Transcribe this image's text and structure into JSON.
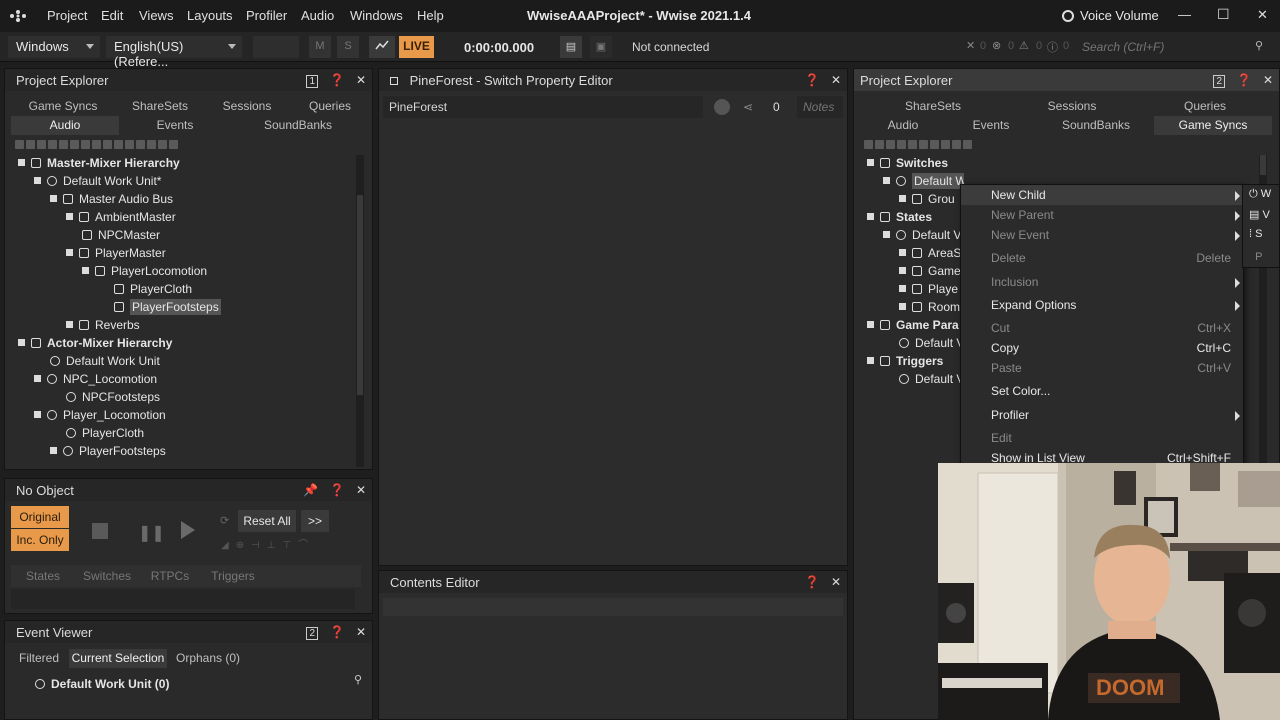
{
  "window": {
    "title": "WwiseAAAProject* - Wwise 2021.1.4",
    "voice_label": "Voice Volume",
    "minimize": "—",
    "maximize": "☐",
    "close": "✕"
  },
  "menu": [
    "Project",
    "Edit",
    "Views",
    "Layouts",
    "Profiler",
    "Audio",
    "Windows",
    "Help"
  ],
  "toolbar": {
    "layout_select": "Windows",
    "language_select": "English(US) (Refere...",
    "m_label": "M",
    "s_label": "S",
    "live_label": "LIVE",
    "time": "0:00:00.000",
    "connection_status": "Not connected",
    "error_count": "0",
    "warning_count": "0",
    "info_count": "0",
    "message_count": "0",
    "search_placeholder": "Search (Ctrl+F)",
    "colors": {
      "live_bg": "#e89a4a",
      "accent": "#e89a4a"
    }
  },
  "left_explorer": {
    "title": "Project Explorer",
    "badge": "1",
    "tabs_row1": [
      "Game Syncs",
      "ShareSets",
      "Sessions",
      "Queries"
    ],
    "tabs_row2": [
      "Audio",
      "Events",
      "SoundBanks"
    ],
    "active_tab": "Audio",
    "tree": [
      "Master-Mixer Hierarchy",
      "Default Work Unit*",
      "Master Audio Bus",
      "AmbientMaster",
      "NPCMaster",
      "PlayerMaster",
      "PlayerLocomotion",
      "PlayerCloth",
      "PlayerFootsteps",
      "Reverbs",
      "Actor-Mixer Hierarchy",
      "Default Work Unit",
      "NPC_Locomotion",
      "NPCFootsteps",
      "Player_Locomotion",
      "PlayerCloth",
      "PlayerFootsteps"
    ]
  },
  "transport": {
    "title": "No Object",
    "original_label": "Original",
    "inc_only_label": "Inc. Only",
    "reset_all_label": "Reset All",
    "more_label": ">>",
    "tabs": [
      "States",
      "Switches",
      "RTPCs",
      "Triggers"
    ]
  },
  "event_viewer": {
    "title": "Event Viewer",
    "badge": "2",
    "tabs": [
      "Filtered",
      "Current Selection",
      "Orphans (0)"
    ],
    "active_tab": "Current Selection",
    "item": "Default Work Unit (0)"
  },
  "switch_editor": {
    "title": "PineForest - Switch Property Editor",
    "name_value": "PineForest",
    "count": "0",
    "notes_placeholder": "Notes"
  },
  "contents_editor": {
    "title": "Contents Editor"
  },
  "right_explorer": {
    "title": "Project Explorer",
    "badge": "2",
    "tabs_row1": [
      "ShareSets",
      "Sessions",
      "Queries"
    ],
    "tabs_row2": [
      "Audio",
      "Events",
      "SoundBanks",
      "Game Syncs"
    ],
    "active_tab": "Game Syncs",
    "tree": [
      "Switches",
      "Default Work Unit*",
      "Grou",
      "States",
      "Default V",
      "AreaS",
      "Game",
      "Playe",
      "Room",
      "Game Para",
      "Default V",
      "Triggers",
      "Default V"
    ]
  },
  "context_menu": {
    "items": [
      {
        "label": "New Child",
        "shortcut": "",
        "submenu": true,
        "disabled": false
      },
      {
        "label": "New Parent",
        "shortcut": "",
        "submenu": true,
        "disabled": true
      },
      {
        "label": "New Event",
        "shortcut": "",
        "submenu": true,
        "disabled": true
      },
      {
        "label": "Delete",
        "shortcut": "Delete",
        "submenu": false,
        "disabled": true
      },
      {
        "label": "Inclusion",
        "shortcut": "",
        "submenu": true,
        "disabled": true
      },
      {
        "label": "Expand Options",
        "shortcut": "",
        "submenu": true,
        "disabled": false
      },
      {
        "label": "Cut",
        "shortcut": "Ctrl+X",
        "submenu": false,
        "disabled": true
      },
      {
        "label": "Copy",
        "shortcut": "Ctrl+C",
        "submenu": false,
        "disabled": false
      },
      {
        "label": "Paste",
        "shortcut": "Ctrl+V",
        "submenu": false,
        "disabled": true
      },
      {
        "label": "Set Color...",
        "shortcut": "",
        "submenu": false,
        "disabled": false
      },
      {
        "label": "Profiler",
        "shortcut": "",
        "submenu": true,
        "disabled": false
      },
      {
        "label": "Edit",
        "shortcut": "",
        "submenu": false,
        "disabled": true
      },
      {
        "label": "Show in List View",
        "shortcut": "Ctrl+Shift+F",
        "submenu": false,
        "disabled": false
      }
    ],
    "submenu_letters": [
      "W",
      "V",
      "S",
      "P"
    ]
  },
  "webcam": {
    "shirt_text": "DOOM"
  }
}
